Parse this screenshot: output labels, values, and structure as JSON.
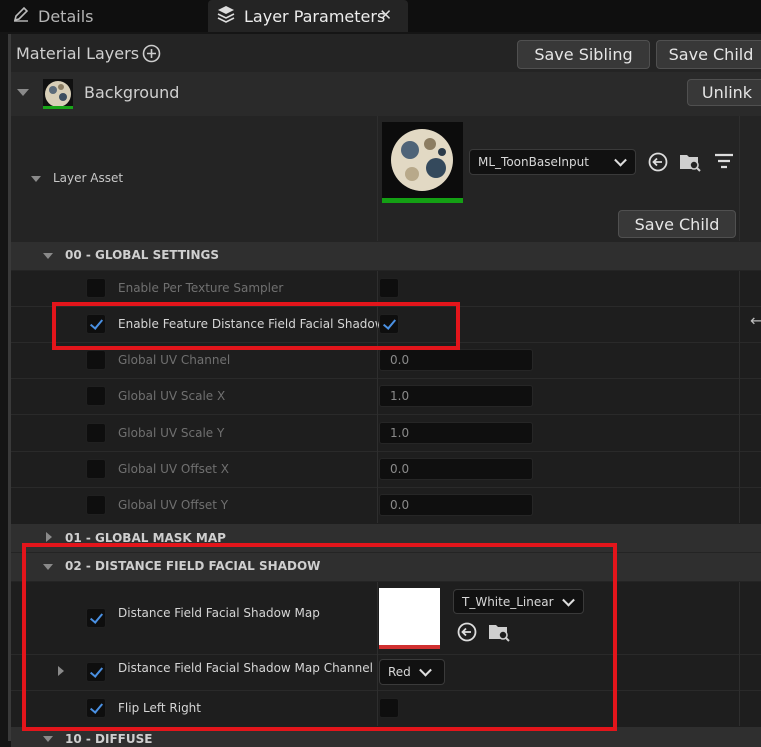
{
  "tabs": [
    {
      "label": "Details",
      "icon": "pencil-icon"
    },
    {
      "label": "Layer Parameters",
      "icon": "layers-icon",
      "close": "✕"
    }
  ],
  "toolbar": {
    "title": "Material Layers",
    "add_icon": "plus-circle-icon",
    "save_sibling": "Save Sibling",
    "save_child": "Save Child"
  },
  "layer": {
    "name": "Background",
    "unlink": "Unlink",
    "asset_label": "Layer Asset",
    "asset_value": "ML_ToonBaseInput",
    "save_child": "Save Child"
  },
  "sections": {
    "global_settings": "00 - GLOBAL SETTINGS",
    "global_mask_map": "01 - GLOBAL MASK MAP",
    "distance_field": "02 - DISTANCE FIELD FACIAL SHADOW",
    "diffuse": "10 - DIFFUSE"
  },
  "global_settings_rows": [
    {
      "label": "Enable Per Texture Sampler",
      "checked": false,
      "value_checked": false
    },
    {
      "label": "Enable Feature Distance Field Facial Shadow",
      "checked": true,
      "value_checked": true
    },
    {
      "label": "Global UV Channel",
      "checked": false,
      "value": "0.0"
    },
    {
      "label": "Global UV Scale X",
      "checked": false,
      "value": "1.0"
    },
    {
      "label": "Global UV Scale Y",
      "checked": false,
      "value": "1.0"
    },
    {
      "label": "Global UV Offset X",
      "checked": false,
      "value": "0.0"
    },
    {
      "label": "Global UV Offset Y",
      "checked": false,
      "value": "0.0"
    }
  ],
  "distance_field_rows": [
    {
      "label": "Distance Field Facial Shadow Map",
      "checked": true,
      "value": "T_White_Linear"
    },
    {
      "label": "Distance Field Facial Shadow Map Channel",
      "checked": true,
      "value": "Red"
    },
    {
      "label": "Flip Left Right",
      "checked": true,
      "value_checked": false
    }
  ],
  "colors": {
    "highlight": "#e3151b",
    "check": "#4a90e2",
    "panel": "#242424"
  }
}
